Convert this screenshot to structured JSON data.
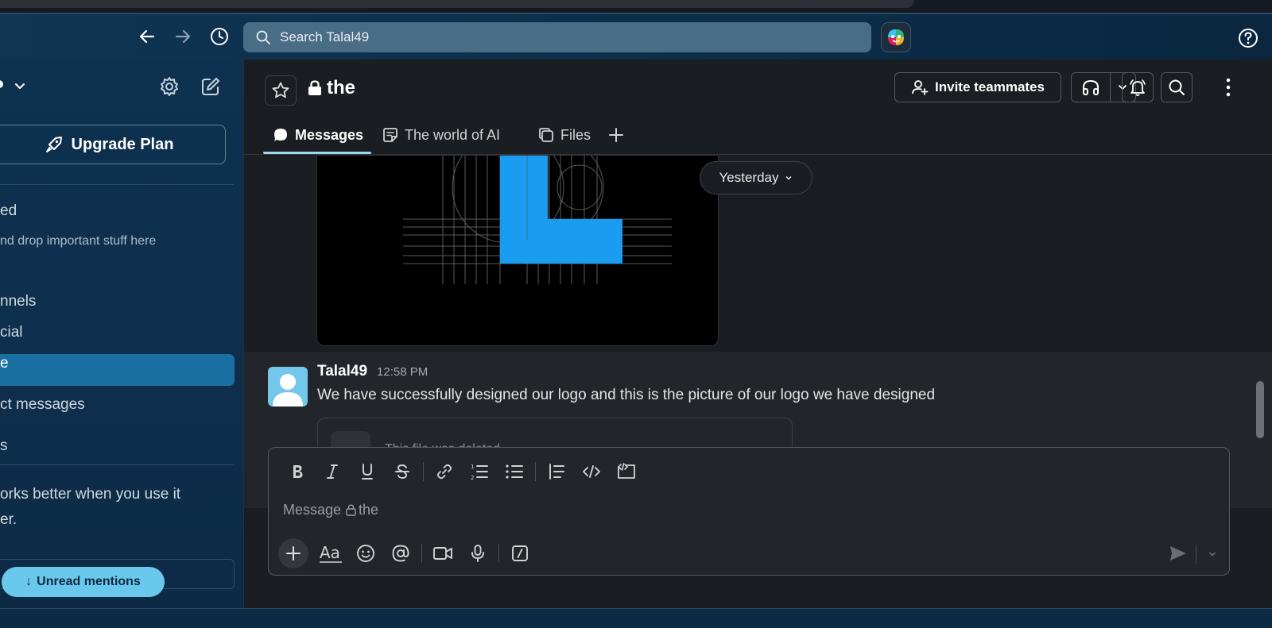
{
  "search": {
    "placeholder": "Search Talal49"
  },
  "sidebar": {
    "upgrade_label": "Upgrade Plan",
    "starred_label": "ed",
    "starred_hint": "nd drop important stuff here",
    "channels_label": "nnels",
    "channels": [
      {
        "label": "cial",
        "active": false
      },
      {
        "label": "e",
        "active": true
      }
    ],
    "dm_label": "ct messages",
    "apps_label": "s",
    "banner_line1": "orks better when you use it",
    "banner_line2": "er.",
    "unread_label": "Unread mentions"
  },
  "channel": {
    "name": "the",
    "invite_label": "Invite teammates"
  },
  "tabs": [
    {
      "label": "Messages",
      "active": true,
      "icon": "message-bubble-icon"
    },
    {
      "label": "The world of AI",
      "active": false,
      "icon": "canvas-doc-icon"
    },
    {
      "label": "Files",
      "active": false,
      "icon": "files-icon"
    }
  ],
  "date_divider": "Yesterday",
  "message": {
    "author": "Talal49",
    "time": "12:58 PM",
    "text": "We have successfully designed our logo and this is the picture of our logo we have designed",
    "file_notice": "This file was deleted."
  },
  "composer": {
    "placeholder_prefix": "Message",
    "placeholder_channel": "the"
  },
  "colors": {
    "sidebar_bg": "#0e3150",
    "main_bg": "#1a1d21",
    "active_item": "#1a6fa3",
    "logo_blue": "#1a9cf0",
    "unread_pill": "#6ac8ec"
  }
}
